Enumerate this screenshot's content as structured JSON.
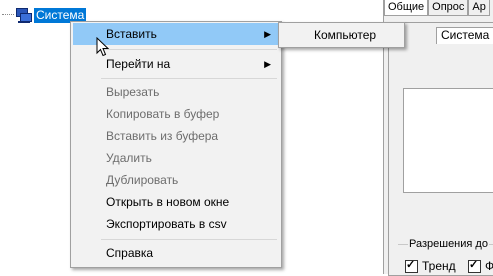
{
  "tree": {
    "root_label": "Система",
    "root_icon": "computer-network-icon"
  },
  "right_panel": {
    "tabs": [
      "Общие",
      "Опрос",
      "Ар"
    ],
    "subtab": "Система",
    "group_label": "Разрешения до",
    "checkboxes": [
      "Тренд",
      "Ф"
    ]
  },
  "context_menu": {
    "items": [
      {
        "label": "Вставить",
        "submenu": true,
        "highlighted": true,
        "enabled": true
      },
      {
        "label": "Перейти на",
        "submenu": true,
        "enabled": true
      },
      {
        "label": "Вырезать",
        "enabled": false
      },
      {
        "label": "Копировать в буфер",
        "enabled": false
      },
      {
        "label": "Вставить из буфера",
        "enabled": false
      },
      {
        "label": "Удалить",
        "enabled": false
      },
      {
        "label": "Дублировать",
        "enabled": false
      },
      {
        "label": "Открыть в новом окне",
        "enabled": true
      },
      {
        "label": "Экспортировать в csv",
        "enabled": true
      },
      {
        "label": "Справка",
        "enabled": true
      }
    ],
    "arrow_icon": "submenu-arrow-icon"
  },
  "submenu": {
    "items": [
      {
        "label": "Компьютер"
      }
    ]
  },
  "colors": {
    "highlight": "#91c9f7",
    "selection": "#0078d7",
    "disabled_text": "#6d6d6d",
    "menu_bg": "#f2f2f2"
  }
}
